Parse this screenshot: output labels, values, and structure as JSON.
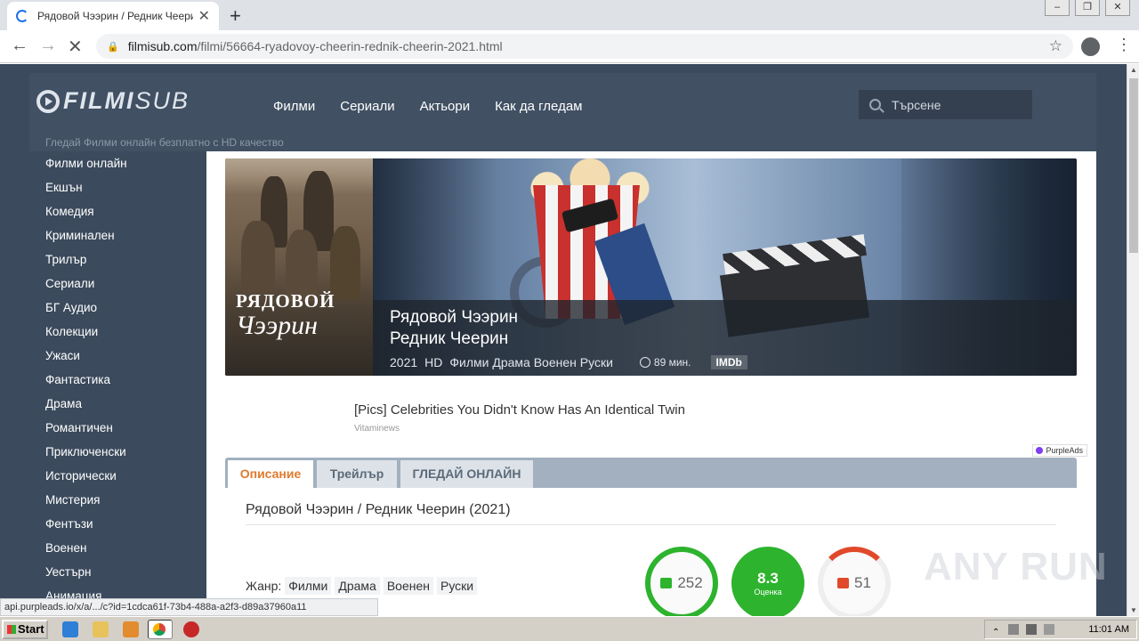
{
  "browser": {
    "tab_title": "Рядовой Чээрин / Редник Чеерин (",
    "url_host": "filmisub.com",
    "url_path": "/filmi/56664-ryadovoy-cheerin-rednik-cheerin-2021.html",
    "status_url": "api.purpleads.io/x/a/.../c?id=1cdca61f-73b4-488a-a2f3-d89a37960a11"
  },
  "site": {
    "logo_bold": "FILMI",
    "logo_light": "SUB",
    "nav": [
      "Филми",
      "Сериали",
      "Актьори",
      "Как да гледам"
    ],
    "search_placeholder": "Търсене",
    "tagline": "Гледай Филми онлайн безплатно с HD качество"
  },
  "sidebar": {
    "items": [
      "Филми онлайн",
      "Екшън",
      "Комедия",
      "Криминален",
      "Трилър",
      "Сериали",
      "БГ Аудио",
      "Колекции",
      "Ужаси",
      "Фантастика",
      "Драма",
      "Романтичен",
      "Приключенски",
      "Исторически",
      "Мистерия",
      "Фентъзи",
      "Военен",
      "Уестърн",
      "Анимация"
    ]
  },
  "movie": {
    "poster_line1": "РЯДОВОЙ",
    "poster_line2": "Чээрин",
    "title_ru": "Рядовой Чээрин",
    "title_bg": "Редник Чеерин",
    "year": "2021",
    "quality": "HD",
    "genres_line": "Филми Драма Военен Руски",
    "duration": "89 мин.",
    "imdb": "IMDb"
  },
  "ad": {
    "title": "[Pics] Celebrities You Didn't Know Has An Identical Twin",
    "source": "Vitaminews",
    "badge": "PurpleAds"
  },
  "tabs": {
    "description": "Описание",
    "trailer": "Трейлър",
    "watch": "ГЛЕДАЙ ОНЛАЙН"
  },
  "details": {
    "heading": "Рядовой Чээрин / Редник Чеерин (2021)",
    "genre_label": "Жанр:",
    "genres": [
      "Филми",
      "Драма",
      "Военен",
      "Руски"
    ],
    "likes": "252",
    "score": "8.3",
    "score_label": "Оценка",
    "dislikes": "51"
  },
  "watermark": "ANY RUN",
  "taskbar": {
    "start": "Start",
    "clock": "11:01 AM"
  },
  "colors": {
    "accent": "#e07a2d",
    "like_green": "#2db32d",
    "dislike_red": "#e0492a",
    "page_bg": "#3b4a5c"
  }
}
